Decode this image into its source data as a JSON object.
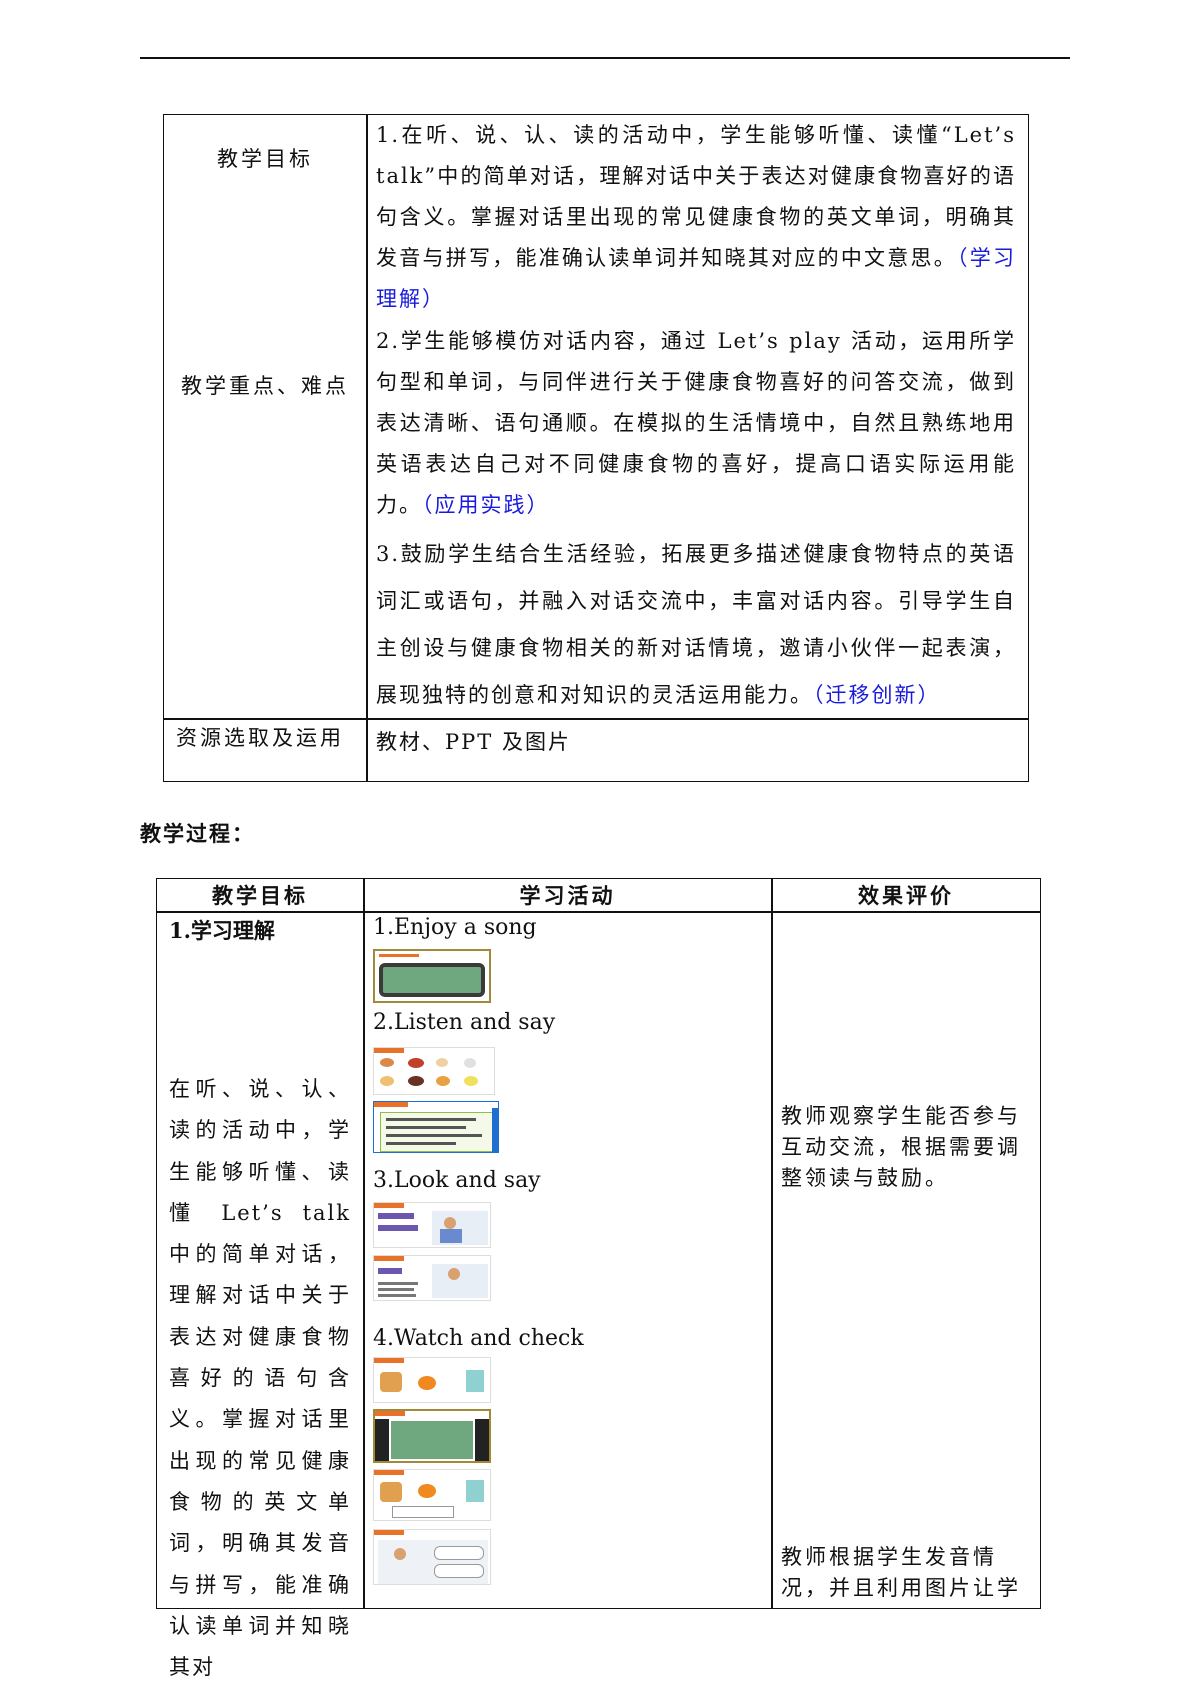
{
  "upper_table": {
    "row1_label": "教学目标",
    "row2_label": "教学重点、难点",
    "row3_label": "资源选取及运用",
    "objective1_text": "1.在听、说、认、读的活动中，学生能够听懂、读懂“Let’s talk”中的简单对话，理解对话中关于表达对健康食物喜好的语句含义。掌握对话里出现的常见健康食物的英文单词，明确其发音与拼写，能准确认读单词并知晓其对应的中文意思。",
    "objective1_tag": "（学习理解）",
    "objective2_text": "2.学生能够模仿对话内容，通过 Let’s play 活动，运用所学句型和单词，与同伴进行关于健康食物喜好的问答交流，做到表达清晰、语句通顺。在模拟的生活情境中，自然且熟练地用英语表达自己对不同健康食物的喜好，提高口语实际运用能力。",
    "objective2_tag": "（应用实践）",
    "objective3_text": "3.鼓励学生结合生活经验，拓展更多描述健康食物特点的英语词汇或语句，并融入对话交流中，丰富对话内容。引导学生自主创设与健康食物相关的新对话情境，邀请小伙伴一起表演，展现独特的创意和对知识的灵活运用能力。",
    "objective3_tag": "（迁移创新）",
    "resources_text": "教材、PPT 及图片"
  },
  "process_heading": "教学过程：",
  "lower_table": {
    "col_goal": "教学目标",
    "col_activity": "学习活动",
    "col_eval": "效果评价",
    "goal_title": "1.学习理解",
    "goal_text": "在听、说、认、读的活动中，学生能够听懂、读懂 Let’s talk 中的简单对话，理解对话中关于表达对健康食物喜好的语句含义。掌握对话里出现的常见健康食物的英文单词，明确其发音与拼写，能准确认读单词并知晓其对",
    "activities": [
      "1.Enjoy a song",
      "2.Listen and say",
      "3.Look and say",
      "4.Watch and check"
    ],
    "eval1": "教师观察学生能否参与互动交流，根据需要调整领读与鼓励。",
    "eval2": "教师根据学生发音情况，并且利用图片让学"
  }
}
